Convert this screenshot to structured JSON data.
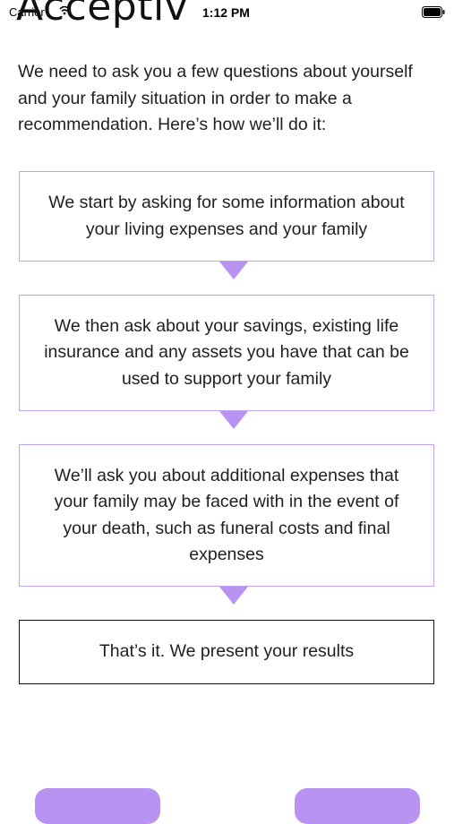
{
  "status_bar": {
    "carrier": "Carrier",
    "time": "1:12 PM"
  },
  "brand": {
    "logo_text": "Acceptiv"
  },
  "intro": {
    "text": "We need to ask you a few questions about yourself and your family situation in order to make a recommendation. Here’s how we’ll do it:"
  },
  "steps": [
    {
      "text": "We start by asking for some information about your living expenses and your family"
    },
    {
      "text": "We then ask about your savings, existing life insurance and any assets you have that can be used to support your family"
    },
    {
      "text": "We’ll ask you about additional expenses that your family may be faced with in the event of your death, such as funeral costs and final expenses"
    },
    {
      "text": "That’s it. We present your results"
    }
  ],
  "colors": {
    "accent": "#b993f2",
    "step_border": "#c1a4f0",
    "final_border": "#111111"
  }
}
